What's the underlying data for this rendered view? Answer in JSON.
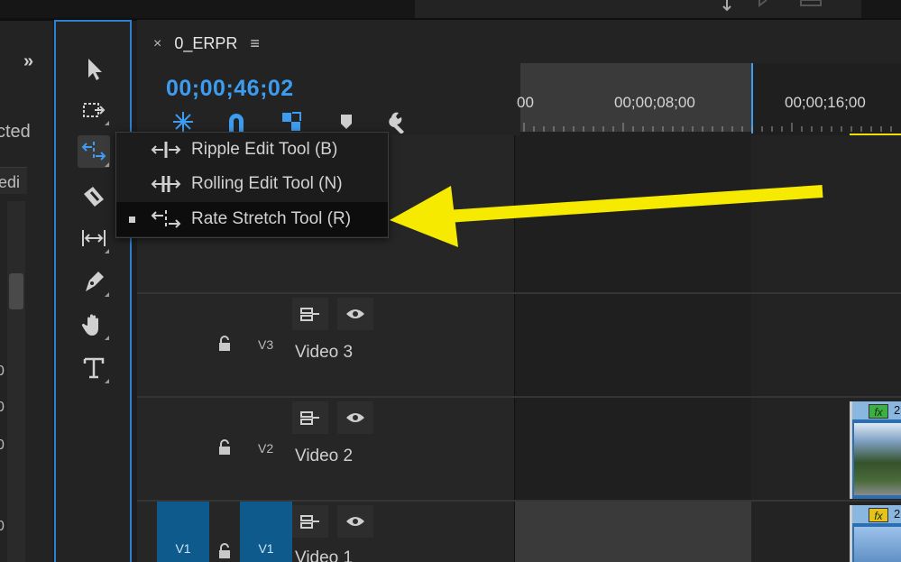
{
  "left_panel": {
    "partial_text_1": "cted",
    "partial_text_2": "edi",
    "numbers": [
      "0",
      "0",
      "0",
      "0"
    ]
  },
  "tools": [
    {
      "name": "selection-tool",
      "icon": "arrow-pointer-icon"
    },
    {
      "name": "track-select-tool",
      "icon": "track-select-icon"
    },
    {
      "name": "rate-stretch-tool",
      "icon": "rate-stretch-icon",
      "active": true
    },
    {
      "name": "razor-tool",
      "icon": "razor-icon"
    },
    {
      "name": "slip-tool",
      "icon": "slip-icon"
    },
    {
      "name": "pen-tool",
      "icon": "pen-icon"
    },
    {
      "name": "hand-tool",
      "icon": "hand-icon"
    },
    {
      "name": "type-tool",
      "icon": "type-icon"
    }
  ],
  "sequence": {
    "close_glyph": "×",
    "name": "0_ERPR",
    "menu_glyph": "≡",
    "timecode": "00;00;46;02"
  },
  "ruler": {
    "labels": [
      "00",
      "00;00;08;00",
      "00;00;16;00"
    ]
  },
  "popup_menu": {
    "items": [
      {
        "label": "Ripple Edit Tool (B)",
        "icon": "ripple-edit-icon",
        "selected": false
      },
      {
        "label": "Rolling Edit Tool (N)",
        "icon": "rolling-edit-icon",
        "selected": false
      },
      {
        "label": "Rate Stretch Tool (R)",
        "icon": "rate-stretch-icon",
        "selected": true
      }
    ]
  },
  "tracks": [
    {
      "id": "V3",
      "name": "Video 3"
    },
    {
      "id": "V2",
      "name": "Video 2"
    },
    {
      "id": "V1",
      "name": "Video 1",
      "source": "V1",
      "target": "V1"
    }
  ],
  "clips": {
    "fx_label": "fx",
    "v2_partial": "2",
    "v1_partial": "2"
  },
  "colors": {
    "accent_blue": "#3d9cf0",
    "annotation_yellow": "#f5ea00",
    "track_target_blue": "#0f5a8c"
  }
}
